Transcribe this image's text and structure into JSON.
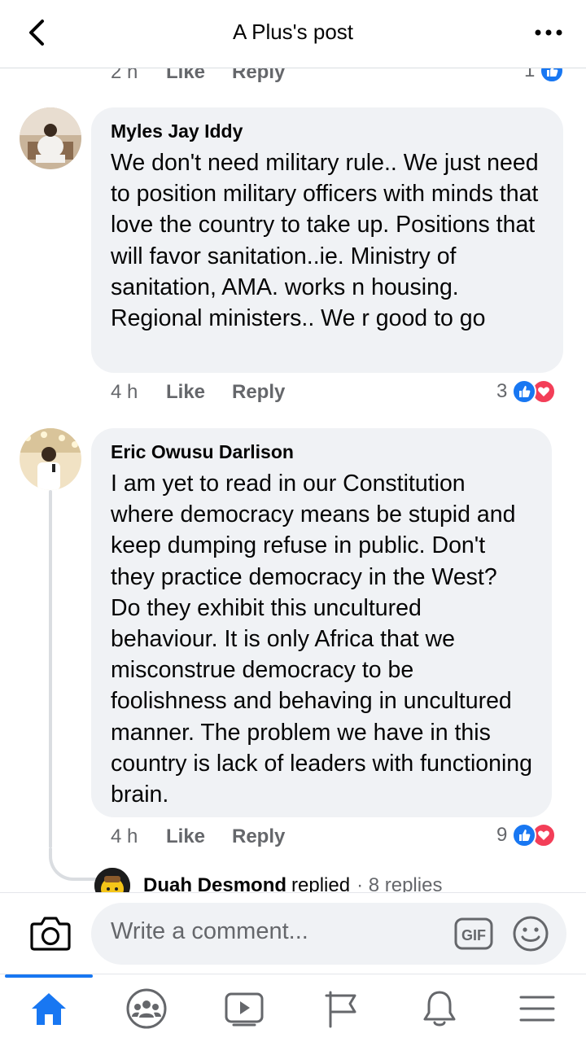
{
  "header": {
    "title": "A Plus's post",
    "back_icon": "chevron-left-icon",
    "more_icon": "more-horizontal-icon"
  },
  "previous_comment": {
    "time": "2 h",
    "like_label": "Like",
    "reply_label": "Reply",
    "reaction_count": "1"
  },
  "comments": [
    {
      "author": "Myles Jay Iddy",
      "text": "We don't need military rule.. We just need to position military officers with minds that love the country to take up. Positions that will favor sanitation..ie. Ministry of sanitation, AMA.  works n housing. Regional ministers.. We r good to go",
      "time": "4 h",
      "like_label": "Like",
      "reply_label": "Reply",
      "reaction_count": "3"
    },
    {
      "author": "Eric Owusu Darlison",
      "text": "I am yet to read in our Constitution where democracy means be stupid and keep dumping refuse in public. Don't they practice democracy in the West? Do they exhibit this uncultured behaviour. It is only Africa that we misconstrue democracy to be foolishness and behaving in uncultured manner. The problem we have in this country is lack of leaders with functioning brain.",
      "time": "4 h",
      "like_label": "Like",
      "reply_label": "Reply",
      "reaction_count": "9",
      "replies": {
        "name": "Duah Desmond",
        "action": "replied",
        "count": "· 8 replies"
      }
    }
  ],
  "composer": {
    "placeholder": "Write a comment...",
    "gif_label": "GIF"
  },
  "nav": {
    "items": [
      "home-icon",
      "groups-icon",
      "watch-icon",
      "pages-flag-icon",
      "notifications-bell-icon",
      "menu-icon"
    ],
    "active": "home-icon"
  },
  "colors": {
    "accent": "#1877f2",
    "love": "#f33e58",
    "bubble": "#f0f2f5",
    "meta_text": "#65676b"
  }
}
